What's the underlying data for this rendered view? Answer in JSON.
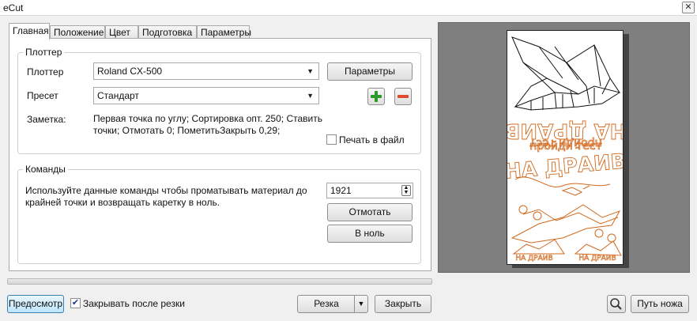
{
  "window": {
    "title": "eCut",
    "close_glyph": "✕"
  },
  "tabs": [
    "Главная",
    "Положение",
    "Цвет",
    "Подготовка",
    "Параметры"
  ],
  "plotter_group": {
    "legend": "Плоттер",
    "plotter_label": "Плоттер",
    "plotter_value": "Roland CX-500",
    "params_button": "Параметры",
    "preset_label": "Пресет",
    "preset_value": "Стандарт",
    "note_label": "Заметка:",
    "note_lines": [
      "Первая точка по углу; Сортировка опт. 250; Ставить",
      "точки; Отмотать 0; ПометитьЗакрыть 0,29;"
    ],
    "print_to_file_label": "Печать в файл",
    "print_to_file_checked": false
  },
  "commands_group": {
    "legend": "Команды",
    "description_lines": [
      "Используйте данные команды чтобы проматывать материал до",
      "крайней точки и возвращать каретку в ноль."
    ],
    "spin_value": "1921",
    "rewind_button": "Отмотать",
    "to_zero_button": "В ноль"
  },
  "preview_art": {
    "line1": "НА ДРАИВ",
    "line2": "пройди тест",
    "line3": "НА ДРАИВ",
    "small_label": "НА ДРАИВ",
    "colors": {
      "cut_lines": "#d2691e",
      "ink": "#111111"
    }
  },
  "footer": {
    "preview_button": "Предосмотр",
    "close_after_cut_label": "Закрывать после резки",
    "close_after_cut_checked": true,
    "cut_button": "Резка",
    "close_button": "Закрыть",
    "knife_path_button": "Путь ножа"
  },
  "icons": {
    "add": "plus-icon",
    "remove": "minus-icon",
    "zoom": "magnifier-icon",
    "dropdown": "chevron-down-icon"
  }
}
